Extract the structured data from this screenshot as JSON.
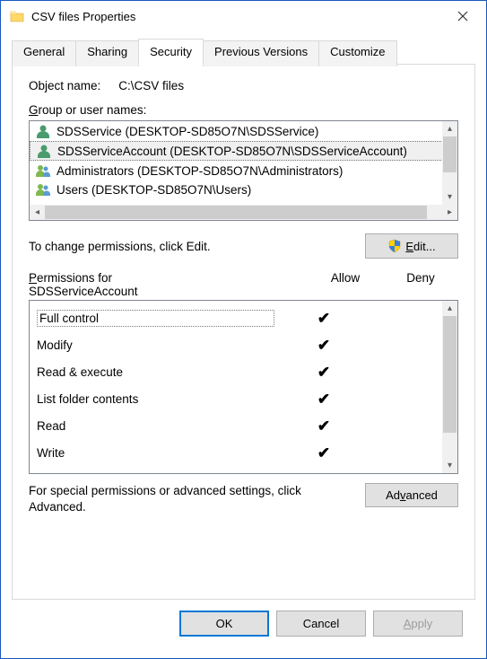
{
  "window": {
    "title": "CSV files Properties"
  },
  "tabs": {
    "general": "General",
    "sharing": "Sharing",
    "security": "Security",
    "previous": "Previous Versions",
    "customize": "Customize"
  },
  "security": {
    "object_label": "Object name:",
    "object_path": "C:\\CSV files",
    "groups_label_pre": "G",
    "groups_label_post": "roup or user names:",
    "users": [
      {
        "name": "SDSService (DESKTOP-SD85O7N\\SDSService)",
        "icon": "single",
        "selected": false
      },
      {
        "name": "SDSServiceAccount (DESKTOP-SD85O7N\\SDSServiceAccount)",
        "icon": "single",
        "selected": true
      },
      {
        "name": "Administrators (DESKTOP-SD85O7N\\Administrators)",
        "icon": "group",
        "selected": false
      },
      {
        "name": "Users (DESKTOP-SD85O7N\\Users)",
        "icon": "group",
        "selected": false
      }
    ],
    "edit_hint": "To change permissions, click Edit.",
    "edit_btn_pre": "E",
    "edit_btn_post": "dit...",
    "perm_label_pre": "P",
    "perm_label_post": "ermissions for",
    "perm_for": "SDSServiceAccount",
    "col_allow": "Allow",
    "col_deny": "Deny",
    "perms": [
      {
        "name": "Full control",
        "allow": true,
        "deny": false
      },
      {
        "name": "Modify",
        "allow": true,
        "deny": false
      },
      {
        "name": "Read & execute",
        "allow": true,
        "deny": false
      },
      {
        "name": "List folder contents",
        "allow": true,
        "deny": false
      },
      {
        "name": "Read",
        "allow": true,
        "deny": false
      },
      {
        "name": "Write",
        "allow": true,
        "deny": false
      }
    ],
    "adv_text": "For special permissions or advanced settings, click Advanced.",
    "adv_btn_pre": "Ad",
    "adv_btn_u": "v",
    "adv_btn_post": "anced"
  },
  "buttons": {
    "ok": "OK",
    "cancel": "Cancel",
    "apply_pre": "A",
    "apply_post": "pply"
  }
}
